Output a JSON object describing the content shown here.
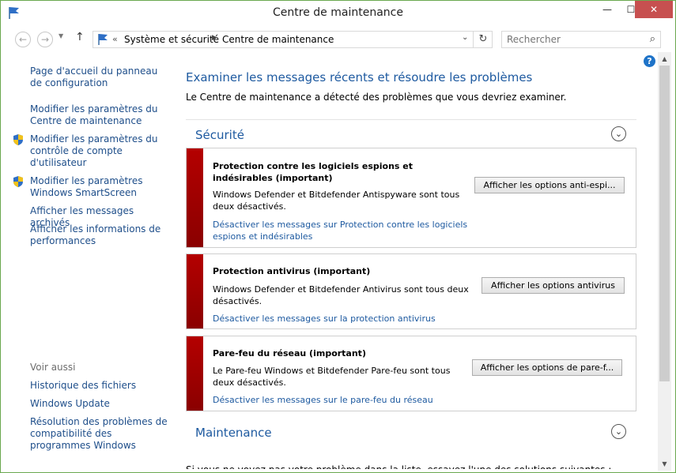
{
  "window": {
    "title": "Centre de maintenance",
    "minimize": "—",
    "maximize": "☐",
    "close": "✕"
  },
  "addressbar": {
    "back": "←",
    "forward": "→",
    "recent": "▼",
    "up": "↑",
    "chevrons": "«",
    "crumbs": [
      "Système et sécurité",
      "Centre de maintenance"
    ],
    "separator": "▶",
    "dropdown": "⌄",
    "refresh": "↻",
    "search_placeholder": "Rechercher",
    "search_glyph": "⌕"
  },
  "help": "?",
  "sidebar": {
    "links": [
      "Page d'accueil du panneau de configuration",
      "Modifier les paramètres du Centre de maintenance",
      "Modifier les paramètres du contrôle de compte d'utilisateur",
      "Modifier les paramètres Windows SmartScreen",
      "Afficher les messages archivés",
      "Afficher les informations de performances"
    ],
    "see_also_label": "Voir aussi",
    "see_also": [
      "Historique des fichiers",
      "Windows Update",
      "Résolution des problèmes de compatibilité des programmes Windows"
    ]
  },
  "main": {
    "title": "Examiner les messages récents et résoudre les problèmes",
    "subtitle": "Le Centre de maintenance a détecté des problèmes que vous devriez examiner.",
    "security_label": "Sécurité",
    "maintenance_label": "Maintenance",
    "chevron": "⌄",
    "alerts": [
      {
        "title": "Protection contre les logiciels espions et indésirables (important)",
        "description": "Windows Defender et Bitdefender Antispyware sont tous deux désactivés.",
        "link": "Désactiver les messages sur Protection contre les logiciels espions et indésirables",
        "button": "Afficher les options anti-espi..."
      },
      {
        "title": "Protection antivirus  (important)",
        "description": "Windows Defender et Bitdefender Antivirus sont tous deux désactivés.",
        "link": "Désactiver les messages sur la protection antivirus",
        "button": "Afficher les options antivirus"
      },
      {
        "title": "Pare-feu du réseau  (important)",
        "description": "Le Pare-feu Windows et Bitdefender Pare-feu sont tous deux désactivés.",
        "link": "Désactiver les messages sur le pare-feu du réseau",
        "button": "Afficher les options de pare-f..."
      }
    ],
    "bottom_text": "Si vous ne voyez pas votre problème dans la liste, essayez l'une des solutions suivantes :"
  },
  "scrollbar": {
    "up": "▲",
    "down": "▼"
  }
}
